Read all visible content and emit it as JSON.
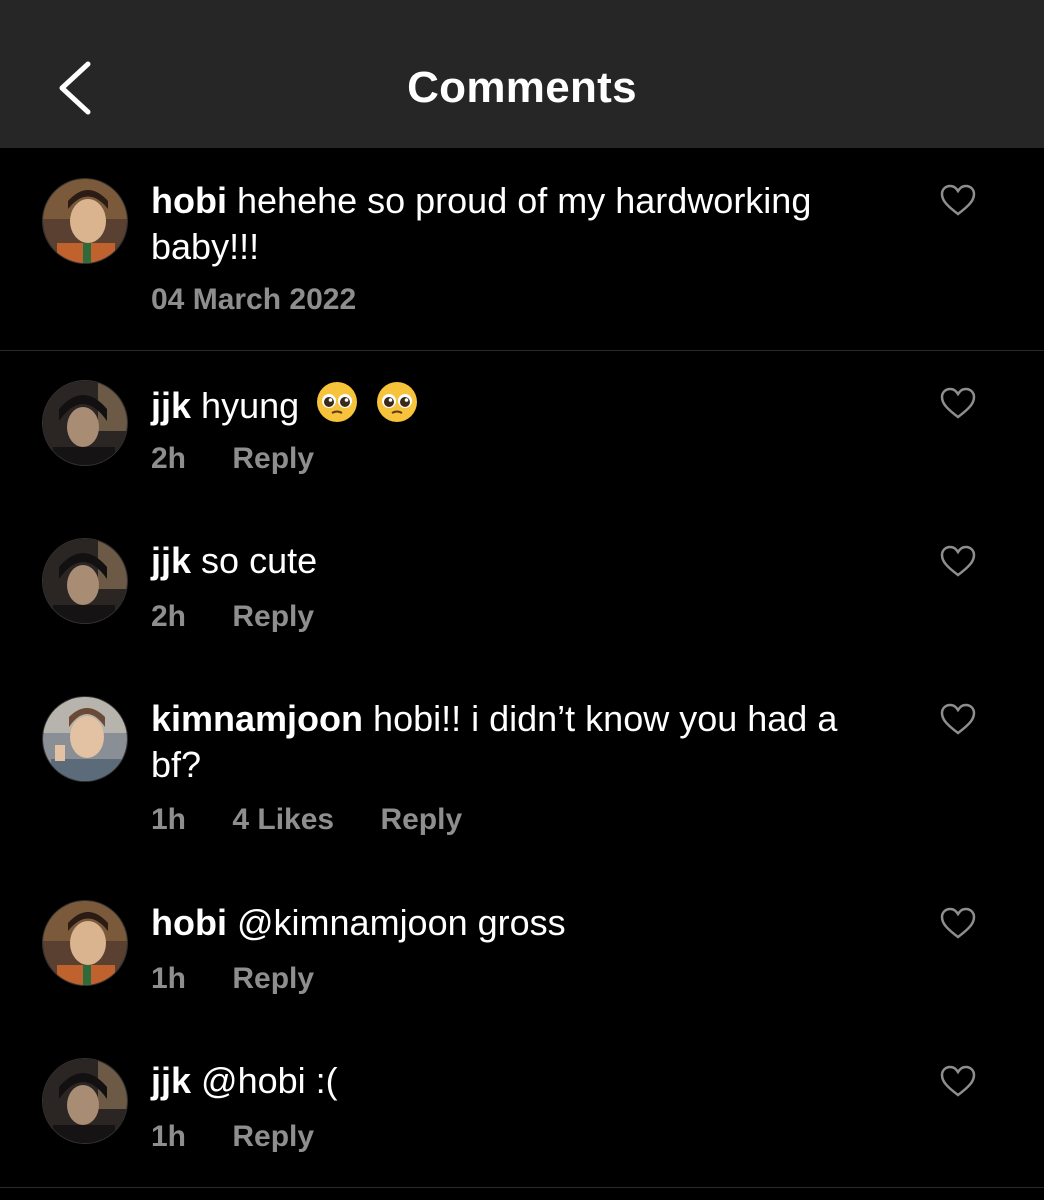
{
  "header": {
    "title": "Comments",
    "back_icon": "chevron-left-icon"
  },
  "caption": {
    "user": "hobi",
    "text": "hehehe so proud of my hardworking baby!!!",
    "date": "04 March 2022"
  },
  "comments": [
    {
      "user": "jjk",
      "text": "hyung",
      "time": "2h",
      "likes": "",
      "reply": "Reply",
      "emoji": "pleading-face-emoji x2"
    },
    {
      "user": "jjk",
      "text": "so cute",
      "time": "2h",
      "likes": "",
      "reply": "Reply"
    },
    {
      "user": "kimnamjoon",
      "text": "hobi!! i didn’t know you had a bf?",
      "time": "1h",
      "likes": "4 Likes",
      "reply": "Reply"
    },
    {
      "user": "hobi",
      "text": "@kimnamjoon gross",
      "time": "1h",
      "likes": "",
      "reply": "Reply"
    },
    {
      "user": "jjk",
      "text": "@hobi :(",
      "time": "1h",
      "likes": "",
      "reply": "Reply"
    }
  ],
  "colors": {
    "background": "#000000",
    "header": "#262626",
    "meta": "#8e8e8e"
  }
}
